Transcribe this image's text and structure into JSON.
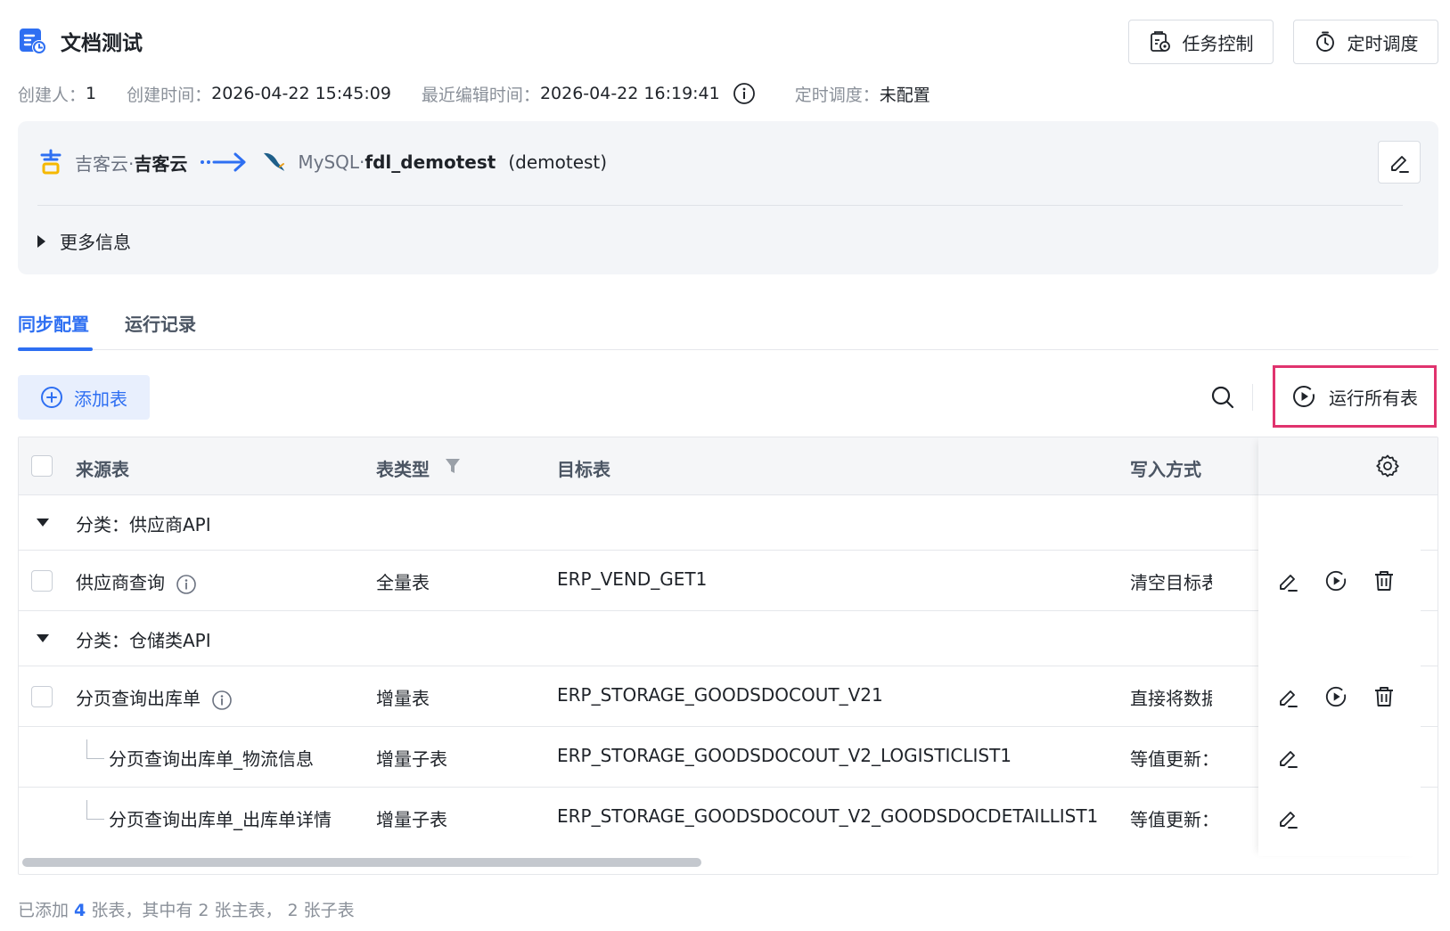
{
  "header": {
    "title": "文档测试",
    "buttons": {
      "task_control": "任务控制",
      "schedule": "定时调度"
    },
    "meta": {
      "creator_label": "创建人：",
      "creator": "1",
      "created_label": "创建时间：",
      "created": "2026-04-22 15:45:09",
      "edited_label": "最近编辑时间：",
      "edited": "2026-04-22 16:19:41",
      "schedule_label": "定时调度：",
      "schedule": "未配置"
    }
  },
  "connection": {
    "source_type": "吉客云·",
    "source_name": "吉客云",
    "target_type": "MySQL·",
    "target_name": "fdl_demotest",
    "target_schema": "(demotest)",
    "more_info": "更多信息"
  },
  "tabs": [
    "同步配置",
    "运行记录"
  ],
  "toolbar": {
    "add_table": "添加表",
    "run_all": "运行所有表"
  },
  "table": {
    "columns": {
      "source": "来源表",
      "type": "表类型",
      "target": "目标表",
      "write": "写入方式"
    },
    "groups": [
      "分类：供应商API",
      "分类：仓储类API"
    ],
    "rows": [
      {
        "source": "供应商查询",
        "type": "全量表",
        "target": "ERP_VEND_GET1",
        "write": "清空目标表"
      },
      {
        "source": "分页查询出库单",
        "type": "增量表",
        "target": "ERP_STORAGE_GOODSDOCOUT_V21",
        "write": "直接将数据"
      },
      {
        "source": "分页查询出库单_物流信息",
        "type": "增量子表",
        "target": "ERP_STORAGE_GOODSDOCOUT_V2_LOGISTICLIST1",
        "write": "等值更新："
      },
      {
        "source": "分页查询出库单_出库单详情",
        "type": "增量子表",
        "target": "ERP_STORAGE_GOODSDOCOUT_V2_GOODSDOCDETAILLIST1",
        "write": "等值更新："
      }
    ]
  },
  "footer": {
    "prefix": "已添加 ",
    "count": "4",
    "suffix": " 张表，其中有 2 张主表， 2 张子表"
  },
  "colors": {
    "accent": "#2e6ff2",
    "highlight": "#e0336e"
  }
}
